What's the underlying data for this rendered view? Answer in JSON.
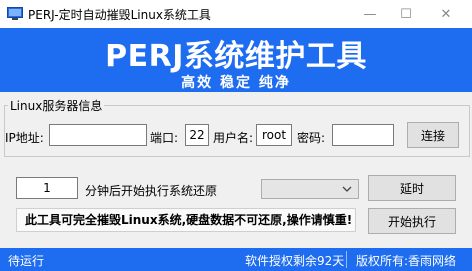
{
  "window": {
    "title": "PERJ-定时自动摧毁Linux系统工具",
    "minimize_glyph": "—",
    "maximize_glyph": "☐",
    "close_glyph": "✕"
  },
  "banner": {
    "title": "PERJ系统维护工具",
    "subtitle": "高效 稳定 纯净",
    "background": "#1e6cf0"
  },
  "server": {
    "group_label": "Linux服务器信息",
    "ip_label": "IP地址:",
    "ip_value": "",
    "port_label": "端口:",
    "port_value": "22",
    "user_label": "用户名:",
    "user_value": "root",
    "password_label": "密码:",
    "password_value": "",
    "connect_label": "连接"
  },
  "schedule": {
    "minutes_value": "1",
    "minutes_suffix": "分钟后开始执行系统还原",
    "mode_selected": "",
    "delay_label": "延时",
    "execute_label": "开始执行",
    "warning": "此工具可完全摧毁Linux系统,硬盘数据不可还原,操作请慎重!"
  },
  "status": {
    "state": "待运行",
    "license": "软件授权剩余92天",
    "copyright": "版权所有:香雨网络"
  }
}
